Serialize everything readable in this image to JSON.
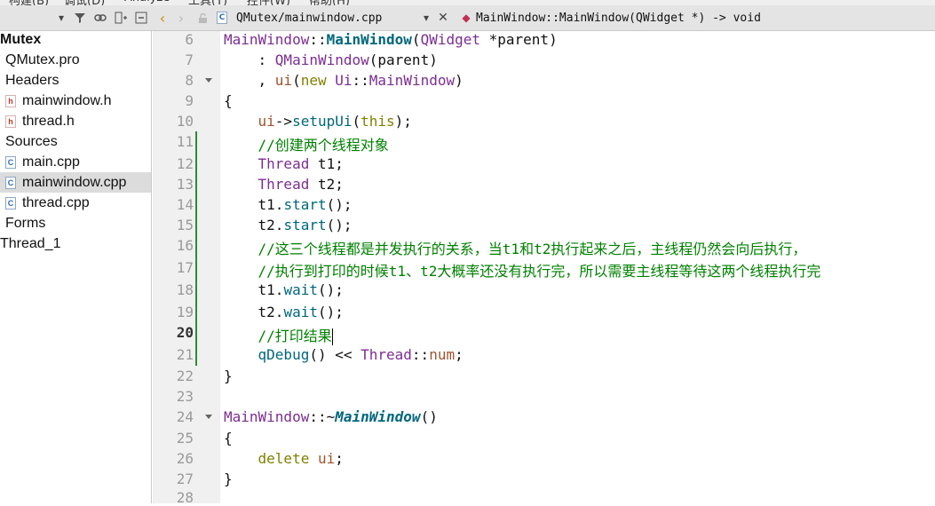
{
  "menubar": {
    "items": [
      "构建(B)",
      "调试(D)",
      "Analyze",
      "工具(T)",
      "控件(W)",
      "帮助(H)"
    ]
  },
  "toolbar": {
    "file_name": "QMutex/mainwindow.cpp",
    "symbol": "MainWindow::MainWindow(QWidget *) -> void"
  },
  "project_tree": {
    "items": [
      {
        "label": "Mutex",
        "level": 0,
        "bold": true,
        "icon": ""
      },
      {
        "label": "QMutex.pro",
        "level": 1,
        "icon": ""
      },
      {
        "label": "Headers",
        "level": 1,
        "icon": ""
      },
      {
        "label": "mainwindow.h",
        "level": 2,
        "icon": "h"
      },
      {
        "label": "thread.h",
        "level": 2,
        "icon": "h"
      },
      {
        "label": "Sources",
        "level": 1,
        "icon": ""
      },
      {
        "label": "main.cpp",
        "level": 2,
        "icon": "c"
      },
      {
        "label": "mainwindow.cpp",
        "level": 2,
        "icon": "c",
        "selected": true
      },
      {
        "label": "thread.cpp",
        "level": 2,
        "icon": "c"
      },
      {
        "label": "Forms",
        "level": 1,
        "icon": ""
      },
      {
        "label": "Thread_1",
        "level": 0,
        "icon": ""
      }
    ]
  },
  "editor": {
    "current_line": 20,
    "lines": [
      {
        "n": 6,
        "fold": false,
        "tokens": [
          [
            "cls",
            "MainWindow"
          ],
          [
            "",
            "::"
          ],
          [
            "fnb",
            "MainWindow"
          ],
          [
            "",
            "("
          ],
          [
            "cls",
            "QWidget"
          ],
          [
            "",
            " *parent)"
          ]
        ]
      },
      {
        "n": 7,
        "fold": false,
        "tokens": [
          [
            "",
            "    : "
          ],
          [
            "cls",
            "QMainWindow"
          ],
          [
            "",
            "(parent)"
          ]
        ]
      },
      {
        "n": 8,
        "fold": true,
        "tokens": [
          [
            "",
            "    , "
          ],
          [
            "mem",
            "ui"
          ],
          [
            "",
            "("
          ],
          [
            "kw",
            "new"
          ],
          [
            "",
            " "
          ],
          [
            "cls",
            "Ui"
          ],
          [
            "",
            "::"
          ],
          [
            "cls",
            "MainWindow"
          ],
          [
            "",
            ")"
          ]
        ]
      },
      {
        "n": 9,
        "fold": false,
        "tokens": [
          [
            "",
            "{"
          ]
        ]
      },
      {
        "n": 10,
        "fold": false,
        "tokens": [
          [
            "",
            "    "
          ],
          [
            "mem",
            "ui"
          ],
          [
            "",
            "->"
          ],
          [
            "fn",
            "setupUi"
          ],
          [
            "",
            "("
          ],
          [
            "kw",
            "this"
          ],
          [
            "",
            ");"
          ]
        ]
      },
      {
        "n": 11,
        "fold": false,
        "tokens": [
          [
            "",
            "    "
          ],
          [
            "cmt",
            "//创建两个线程对象"
          ]
        ]
      },
      {
        "n": 12,
        "fold": false,
        "tokens": [
          [
            "",
            "    "
          ],
          [
            "cls",
            "Thread"
          ],
          [
            "",
            " t1;"
          ]
        ]
      },
      {
        "n": 13,
        "fold": false,
        "tokens": [
          [
            "",
            "    "
          ],
          [
            "cls",
            "Thread"
          ],
          [
            "",
            " t2;"
          ]
        ]
      },
      {
        "n": 14,
        "fold": false,
        "tokens": [
          [
            "",
            "    t1."
          ],
          [
            "fn",
            "start"
          ],
          [
            "",
            "();"
          ]
        ]
      },
      {
        "n": 15,
        "fold": false,
        "tokens": [
          [
            "",
            "    t2."
          ],
          [
            "fn",
            "start"
          ],
          [
            "",
            "();"
          ]
        ]
      },
      {
        "n": 16,
        "fold": false,
        "tokens": [
          [
            "",
            "    "
          ],
          [
            "cmt",
            "//这三个线程都是并发执行的关系，当t1和t2执行起来之后，主线程仍然会向后执行，"
          ]
        ]
      },
      {
        "n": 17,
        "fold": false,
        "tokens": [
          [
            "",
            "    "
          ],
          [
            "cmt",
            "//执行到打印的时候t1、t2大概率还没有执行完，所以需要主线程等待这两个线程执行完"
          ]
        ]
      },
      {
        "n": 18,
        "fold": false,
        "tokens": [
          [
            "",
            "    t1."
          ],
          [
            "fn",
            "wait"
          ],
          [
            "",
            "();"
          ]
        ]
      },
      {
        "n": 19,
        "fold": false,
        "tokens": [
          [
            "",
            "    t2."
          ],
          [
            "fn",
            "wait"
          ],
          [
            "",
            "();"
          ]
        ]
      },
      {
        "n": 20,
        "fold": false,
        "cursor": true,
        "tokens": [
          [
            "",
            "    "
          ],
          [
            "cmt",
            "//打印结果"
          ]
        ]
      },
      {
        "n": 21,
        "fold": false,
        "tokens": [
          [
            "",
            "    "
          ],
          [
            "fn",
            "qDebug"
          ],
          [
            "",
            "() << "
          ],
          [
            "cls",
            "Thread"
          ],
          [
            "",
            "::"
          ],
          [
            "mem",
            "num"
          ],
          [
            "",
            ";"
          ]
        ]
      },
      {
        "n": 22,
        "fold": false,
        "tokens": [
          [
            "",
            "}"
          ]
        ]
      },
      {
        "n": 23,
        "fold": false,
        "tokens": []
      },
      {
        "n": 24,
        "fold": true,
        "tokens": [
          [
            "cls",
            "MainWindow"
          ],
          [
            "",
            "::~"
          ],
          [
            "fni",
            "MainWindow"
          ],
          [
            "",
            "()"
          ]
        ]
      },
      {
        "n": 25,
        "fold": false,
        "tokens": [
          [
            "",
            "{"
          ]
        ]
      },
      {
        "n": 26,
        "fold": false,
        "tokens": [
          [
            "",
            "    "
          ],
          [
            "kw",
            "delete"
          ],
          [
            "",
            " "
          ],
          [
            "mem",
            "ui"
          ],
          [
            "",
            ";"
          ]
        ]
      },
      {
        "n": 27,
        "fold": false,
        "tokens": [
          [
            "",
            "}"
          ]
        ]
      },
      {
        "n": 28,
        "fold": false,
        "tokens": []
      }
    ]
  },
  "icons": {
    "dropdown": "chevron-down-icon",
    "filter": "filter-icon",
    "link": "link-icon",
    "split": "split-icon",
    "close_pane": "close-pane-icon",
    "back": "arrow-left-icon",
    "forward": "arrow-right-icon",
    "lock": "lock-icon",
    "cpp_file": "cpp-file-icon",
    "close_doc": "close-icon",
    "symbol": "symbol-diamond-icon"
  }
}
